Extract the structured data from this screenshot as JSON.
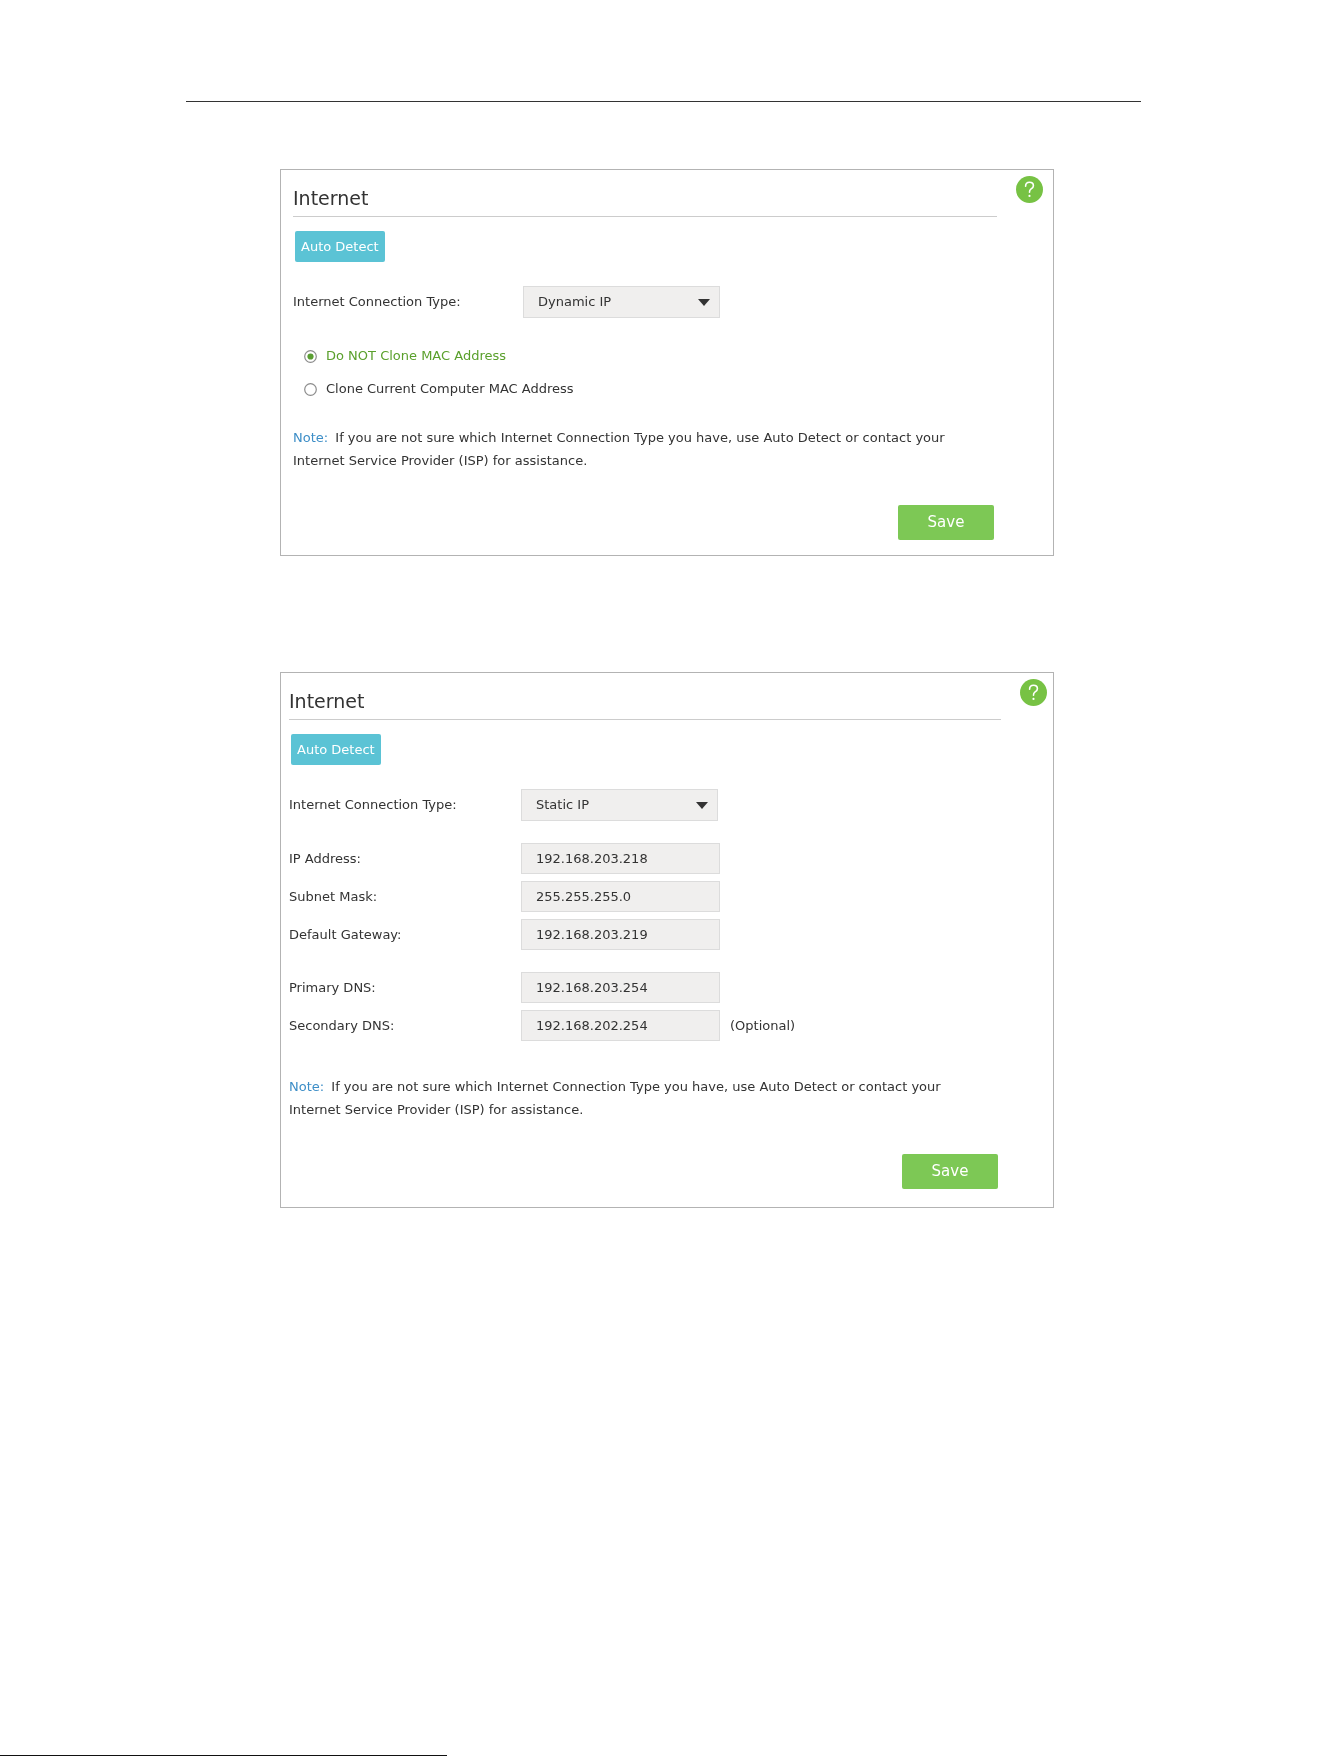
{
  "panels": [
    {
      "title": "Internet",
      "auto_detect_button": "Auto Detect",
      "connection_type": {
        "label": "Internet Connection Type:",
        "value": "Dynamic IP"
      },
      "mac_options": [
        {
          "label": "Do NOT Clone MAC Address",
          "selected": true
        },
        {
          "label": "Clone Current Computer MAC Address",
          "selected": false
        }
      ],
      "note": {
        "label": "Note:",
        "text": "If you are not sure which Internet Connection Type you have, use Auto Detect or contact your Internet Service Provider (ISP) for assistance."
      },
      "save_button": "Save"
    },
    {
      "title": "Internet",
      "auto_detect_button": "Auto Detect",
      "connection_type": {
        "label": "Internet Connection Type:",
        "value": "Static IP"
      },
      "field_groups": [
        {
          "fields": [
            {
              "label": "IP Address:",
              "value": "192.168.203.218"
            },
            {
              "label": "Subnet Mask:",
              "value": "255.255.255.0"
            },
            {
              "label": "Default Gateway:",
              "value": "192.168.203.219"
            }
          ]
        },
        {
          "fields": [
            {
              "label": "Primary DNS:",
              "value": "192.168.203.254"
            },
            {
              "label": "Secondary DNS:",
              "value": "192.168.202.254",
              "hint": "(Optional)"
            }
          ]
        }
      ],
      "note": {
        "label": "Note:",
        "text": "If you are not sure which Internet Connection Type you have, use Auto Detect or contact your Internet Service Provider (ISP) for assistance."
      },
      "save_button": "Save"
    }
  ]
}
